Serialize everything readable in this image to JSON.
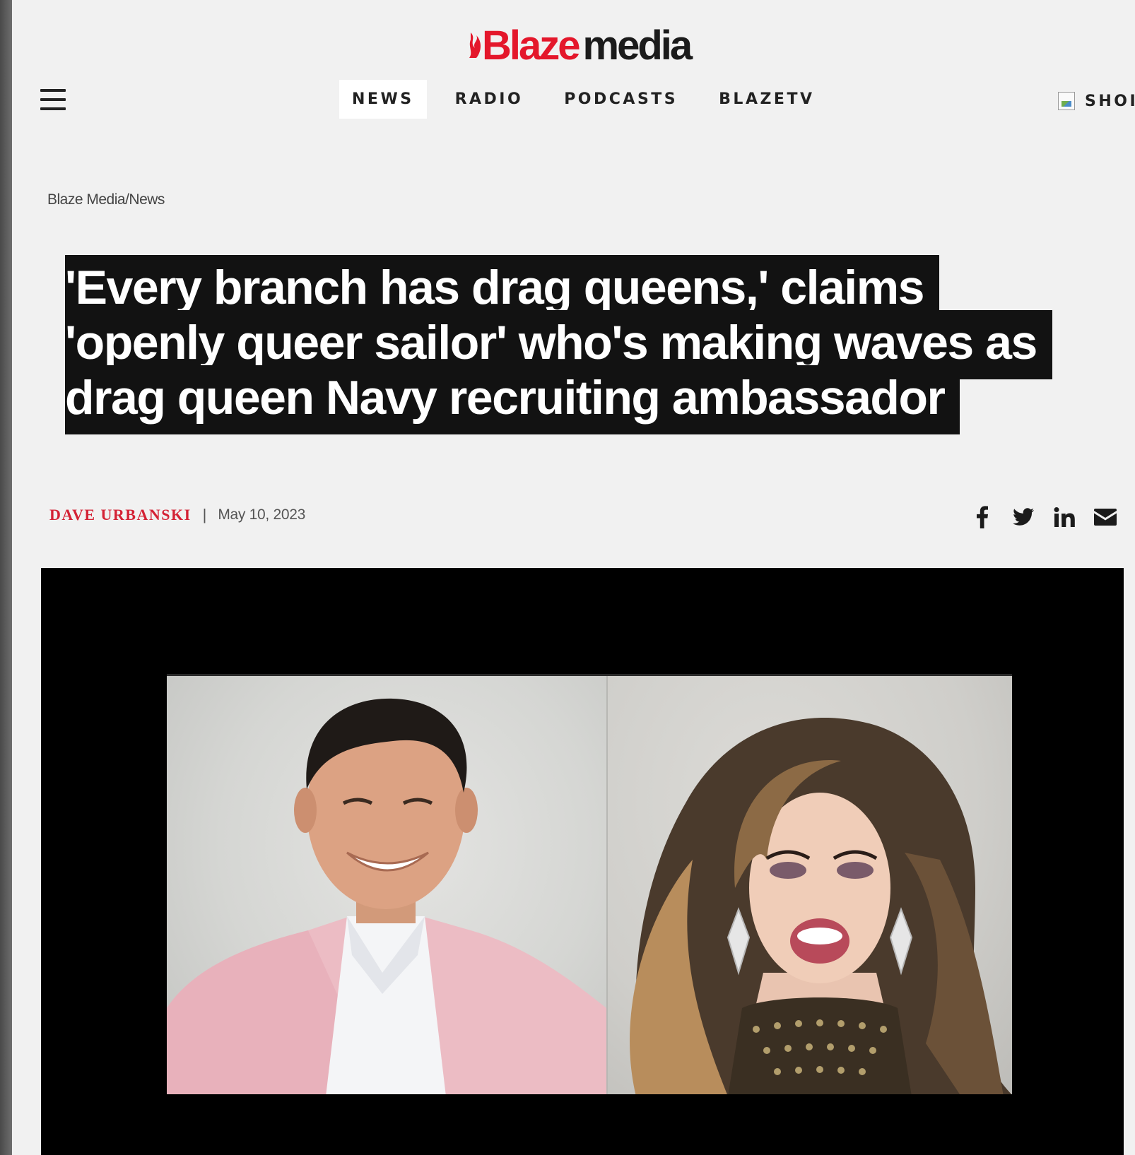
{
  "site": {
    "brand": "Blaze",
    "brand_suffix": "media",
    "colors": {
      "brand_red": "#e4172b",
      "author_red": "#d42235",
      "headline_bg": "#121212",
      "page_bg": "#f1f1f1"
    }
  },
  "header": {
    "menu_icon": "hamburger-icon",
    "nav": [
      {
        "label": "NEWS",
        "active": true
      },
      {
        "label": "RADIO",
        "active": false
      },
      {
        "label": "PODCASTS",
        "active": false
      },
      {
        "label": "BLAZETV",
        "active": false
      }
    ],
    "shop": {
      "label": "SHOI",
      "icon": "broken-image-icon"
    }
  },
  "breadcrumb": {
    "items": [
      "Blaze Media",
      "News"
    ],
    "separator": "/"
  },
  "article": {
    "headline_lines": [
      "'Every branch has drag queens,' claims",
      "'openly queer sailor' who's making waves as",
      "drag queen Navy recruiting ambassador"
    ],
    "author": "DAVE URBANSKI",
    "separator": "|",
    "date": "May 10, 2023",
    "share_icons": [
      "facebook-icon",
      "twitter-icon",
      "linkedin-icon",
      "email-icon"
    ]
  },
  "media": {
    "type": "video",
    "panels": [
      "left-speaker",
      "right-speaker"
    ]
  }
}
